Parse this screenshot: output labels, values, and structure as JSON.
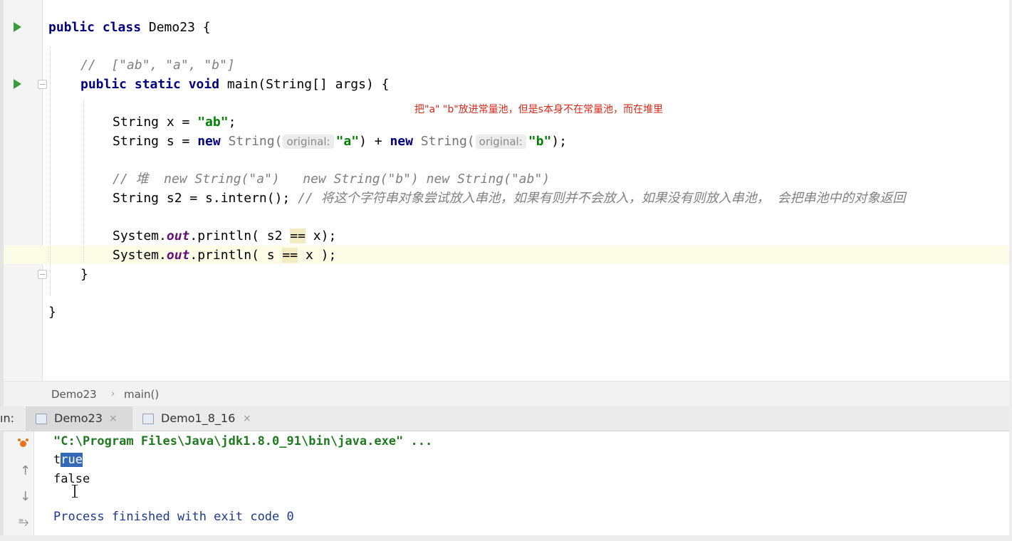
{
  "editor": {
    "lines": {
      "class_kw": "public class",
      "class_name": " Demo23 {",
      "comment_top": "//  [\"ab\", \"a\", \"b\"]",
      "main_kw": "public static void",
      "main_sig": " main(String[] args) {",
      "x_decl_pre": "String x = ",
      "x_decl_str": "\"ab\"",
      "x_decl_post": ";",
      "s_decl_pre": "String s = ",
      "s_new1": "new",
      "s_type1": " String(",
      "s_hint1": "original:",
      "s_str1": "\"a\"",
      "s_mid": ") + ",
      "s_new2": "new",
      "s_type2": " String(",
      "s_hint2": "original:",
      "s_str2": "\"b\"",
      "s_post": ");",
      "comment_heap": "// 堆  new String(\"a\")   new String(\"b\") new String(\"ab\")",
      "s2_decl": "String s2 = s.intern(); ",
      "s2_comment": "// 将这个字符串对象尝试放入串池，如果有则并不会放入，如果没有则放入串池， 会把串池中的对象返回",
      "p1_pre": "System.",
      "p1_out": "out",
      "p1_mid": ".println( s2 ",
      "p1_op": "==",
      "p1_post": " x);",
      "p2_pre": "System.",
      "p2_out": "out",
      "p2_mid": ".println( s ",
      "p2_op": "==",
      "p2_post": " x );",
      "close_main": "}",
      "close_class": "}"
    },
    "annotation": "把\"a\" \"b\"放进常量池，但是s本身不在常量池，而在堆里"
  },
  "breadcrumb": {
    "items": [
      "Demo23",
      "main()"
    ],
    "separator": "›"
  },
  "run_panel": {
    "label": "ın:",
    "tabs": [
      {
        "label": "Demo23",
        "close": "×",
        "active": true
      },
      {
        "label": "Demo1_8_16",
        "close": "×",
        "active": false
      }
    ]
  },
  "console": {
    "cmd_line": "\"C:\\Program Files\\Java\\jdk1.8.0_91\\bin\\java.exe\" ...",
    "out1_pre": "t",
    "out1_sel": "rue",
    "out2": "false",
    "exit": "Process finished with exit code 0",
    "icons": [
      "bug-icon",
      "arrow-up-icon",
      "arrow-down-icon",
      "soft-wrap-icon"
    ]
  },
  "colors": {
    "keyword": "#000080",
    "string": "#008000",
    "comment": "#808080",
    "field": "#660e7a",
    "annotation": "#d6281a",
    "run_icon": "#3a9c3a",
    "selection": "#3469b7"
  }
}
